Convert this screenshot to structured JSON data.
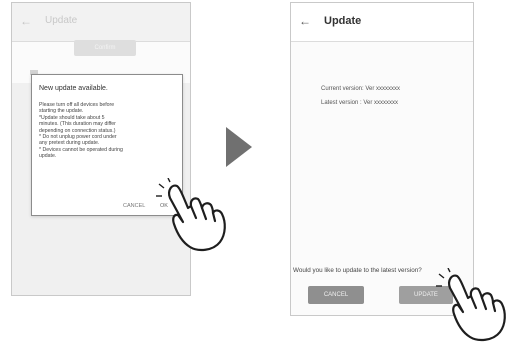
{
  "left_screen": {
    "back_glyph": "←",
    "title": "Update",
    "confirm_label": "Confirm"
  },
  "dialog": {
    "title": "New update available.",
    "body_lines": [
      "Please turn off all devices before",
      "starting the update.",
      "*Update should take about 5",
      "minutes. (This duration may differ",
      "depending on connection status.)",
      "* Do not unplug power cord under",
      "any pretext during update.",
      "* Devices cannot be operated during",
      "update."
    ],
    "cancel_label": "CANCEL",
    "ok_label": "OK"
  },
  "right_screen": {
    "back_glyph": "←",
    "title": "Update",
    "current_version": "Current version: Ver xxxxxxxx",
    "latest_version": "Latest version   : Ver xxxxxxxx",
    "question": "Would you like to update to the latest version?",
    "cancel_label": "CANCEL",
    "update_label": "UPDATE"
  },
  "icons": {
    "arrow": "right-triangle-arrow",
    "tap": "tapping-hand"
  },
  "colors": {
    "arrow": "#707070",
    "button_cancel": "#8f8f8f",
    "button_update": "#9f9f9f",
    "dialog_border": "#8c8c8c"
  }
}
